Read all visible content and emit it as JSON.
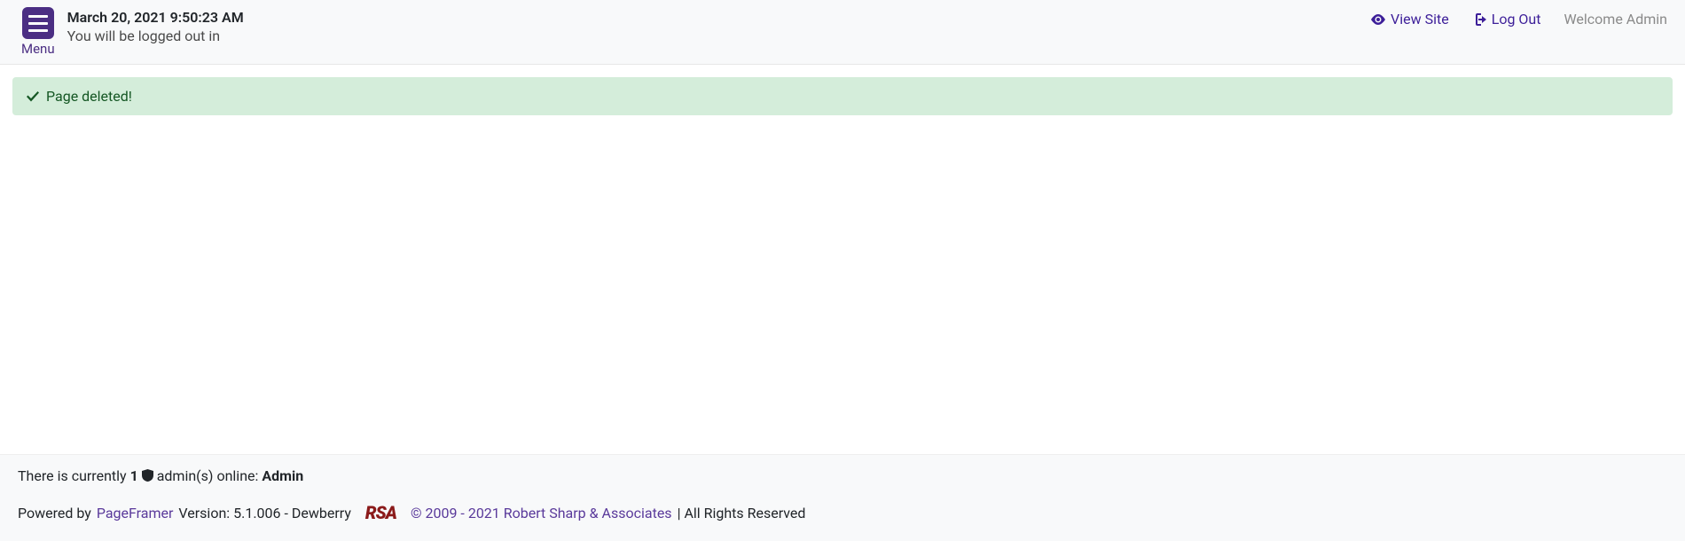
{
  "header": {
    "timestamp": "March 20, 2021 9:50:23 AM",
    "logout_msg": "You will be logged out in",
    "menu_label": "Menu",
    "view_site_label": "View Site",
    "log_out_label": "Log Out",
    "welcome_label": "Welcome Admin"
  },
  "alert": {
    "message": "Page deleted!"
  },
  "footer": {
    "currently_prefix": "There is currently ",
    "admin_count": "1",
    "admins_online_text": " admin(s) online: ",
    "admin_name": "Admin",
    "powered_by_prefix": "Powered by ",
    "pageframer_label": "PageFramer",
    "version_text": " Version: 5.1.006 - Dewberry",
    "rsa_logo_text": "RSA",
    "copyright_link": "© 2009 - 2021 Robert Sharp & Associates",
    "rights_text": " | All Rights Reserved"
  }
}
